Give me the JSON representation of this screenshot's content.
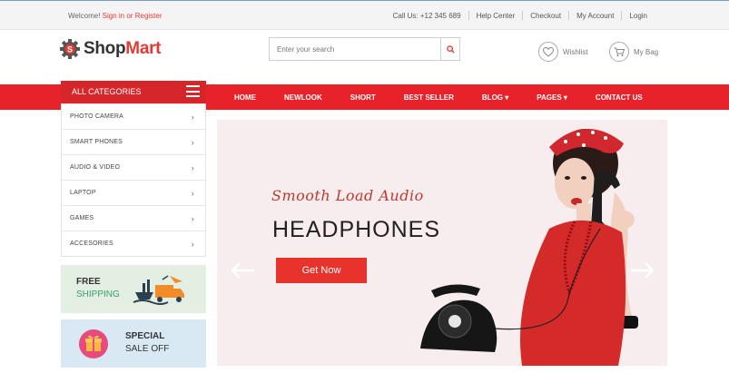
{
  "topbar": {
    "welcome_prefix": "Welcome!",
    "sign_in": "Sign in",
    "or": "or",
    "register": "Register",
    "call_us": "Call Us: +12 345 689",
    "help_center": "Help Center",
    "checkout": "Checkout",
    "my_account": "My Account",
    "login": "Login"
  },
  "header": {
    "logo_shop": "Shop",
    "logo_mart": "Mart",
    "search_placeholder": "Enter your search",
    "wishlist": "Wishlist",
    "my_bag": "My Bag"
  },
  "nav": {
    "items": [
      "HOME",
      "NEWLOOK",
      "SHORT",
      "BEST SELLER",
      "BLOG ▾",
      "PAGES ▾",
      "CONTACT US"
    ]
  },
  "categories": {
    "title": "ALL CATEGORIES",
    "items": [
      "PHOTO CAMERA",
      "SMART PHONES",
      "AUDIO & VIDEO",
      "LAPTOP",
      "GAMES",
      "ACCESORIES"
    ]
  },
  "promos": {
    "free_line1": "FREE",
    "free_line2": "SHIPPING",
    "special_line1": "SPECIAL",
    "special_line2": "SALE OFF"
  },
  "slider": {
    "script_text": "Smooth Load Audio",
    "headline": "HEADPHONES",
    "button": "Get Now"
  },
  "colors": {
    "brand_red": "#e8222a",
    "category_header": "#d5262c",
    "slider_bg": "#f7ecee"
  }
}
